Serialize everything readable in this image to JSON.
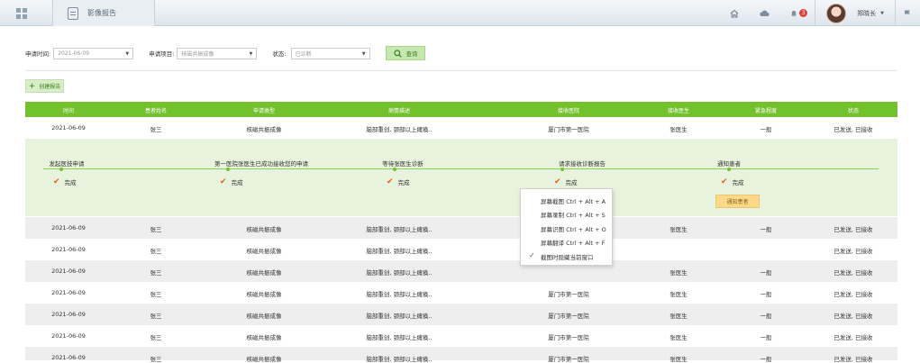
{
  "header": {
    "tab_label": "影像报告",
    "user_name": "郑晓长",
    "notification_count": "3",
    "icons": [
      "dashboard-grid-icon",
      "report-icon",
      "home-icon",
      "cloud-icon",
      "bell-icon",
      "caret-down-icon",
      "flag-icon"
    ]
  },
  "filters": {
    "date_label": "申请时间:",
    "date_value": "2021-06-09",
    "item_label": "申请项目:",
    "item_value": "核磁共振成像",
    "status_label": "状态:",
    "status_value": "已诊断",
    "query_label": "查询"
  },
  "new_report_label": "创建报告",
  "table": {
    "columns": [
      "时间",
      "患者姓名",
      "申请类型",
      "病情描述",
      "接收医院",
      "接收医生",
      "紧急程度",
      "状态"
    ],
    "expanded_row": [
      "2021-06-09",
      "张三",
      "核磁共振成像",
      "脑部重创, 颈部以上瘫痪..",
      "厦门市第一医院",
      "张医生",
      "一般",
      "已发送, 已接收"
    ],
    "rows": [
      [
        "2021-06-09",
        "张三",
        "核磁共振成像",
        "脑部重创, 颈部以上瘫痪..",
        "",
        "张医生",
        "一般",
        "已发送, 已接收"
      ],
      [
        "2021-06-09",
        "张三",
        "核磁共振成像",
        "脑部重创, 颈部以上瘫痪..",
        "",
        "",
        "",
        "已发送, 已接收"
      ],
      [
        "2021-06-09",
        "张三",
        "核磁共振成像",
        "脑部重创, 颈部以上瘫痪..",
        "",
        "张医生",
        "一般",
        "已发送, 已接收"
      ],
      [
        "2021-06-09",
        "张三",
        "核磁共振成像",
        "脑部重创, 颈部以上瘫痪..",
        "厦门市第一医院",
        "张医生",
        "一般",
        "已发送, 已接收"
      ],
      [
        "2021-06-09",
        "张三",
        "核磁共振成像",
        "脑部重创, 颈部以上瘫痪..",
        "厦门市第一医院",
        "张医生",
        "一般",
        "已发送, 已接收"
      ],
      [
        "2021-06-09",
        "张三",
        "核磁共振成像",
        "脑部重创, 颈部以上瘫痪..",
        "厦门市第一医院",
        "张医生",
        "一般",
        "已发送, 已接收"
      ],
      [
        "2021-06-09",
        "张三",
        "核磁共振成像",
        "脑部重创, 颈部以上瘫痪..",
        "厦门市第一医院",
        "张医生",
        "一般",
        "已发送, 已接收"
      ]
    ]
  },
  "progress": {
    "steps": [
      {
        "title": "发起医技申请",
        "status": "完成"
      },
      {
        "title": "第一医院张医生已成功接收您的申请",
        "status": "完成"
      },
      {
        "title": "等待张医生诊断",
        "status": "完成"
      },
      {
        "title": "请求接收诊断报告",
        "status": "完成"
      },
      {
        "title": "通知患者",
        "status": "完成"
      }
    ],
    "notify_label": "通知患者"
  },
  "context_menu": {
    "items": [
      "屏幕截图 Ctrl + Alt + A",
      "屏幕录制 Ctrl + Alt + S",
      "屏幕识图 Ctrl + Alt + O",
      "屏幕翻译 Ctrl + Alt + F",
      "截图时隐藏当前窗口"
    ]
  },
  "colors": {
    "accent_green": "#74c12e",
    "panel_green": "#e7f3dc",
    "notify_yellow": "#fbd98a",
    "badge_red": "#e0413c",
    "check_orange": "#f05a1a"
  }
}
